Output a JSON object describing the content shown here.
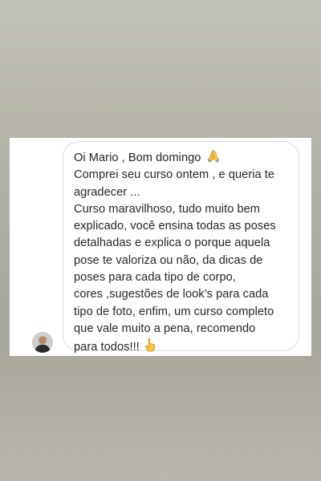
{
  "message": {
    "greeting": "Oi Mario , Bom domingo",
    "greeting_emoji": "folded-hands-icon",
    "line2": "Comprei seu curso ontem , e queria te",
    "line3": "agradecer ...",
    "line4": "Curso maravilhoso, tudo muito bem",
    "line5": "explicado, você ensina todas as poses",
    "line6": "detalhadas e explica o porque aquela",
    "line7": "pose te valoriza ou não, da dicas de",
    "line8": "poses para cada tipo de corpo,",
    "line9": "cores ,sugestões de look’s para cada",
    "line10": "tipo de foto, enfim, um curso completo",
    "line11": "que vale muito a pena, recomendo",
    "closing": "para todos!!!",
    "closing_emoji": "pointing-finger-icon"
  },
  "colors": {
    "background": "#b3b1a6",
    "card": "#ffffff",
    "bubble_border": "#d9d9d9",
    "text": "#262626"
  }
}
